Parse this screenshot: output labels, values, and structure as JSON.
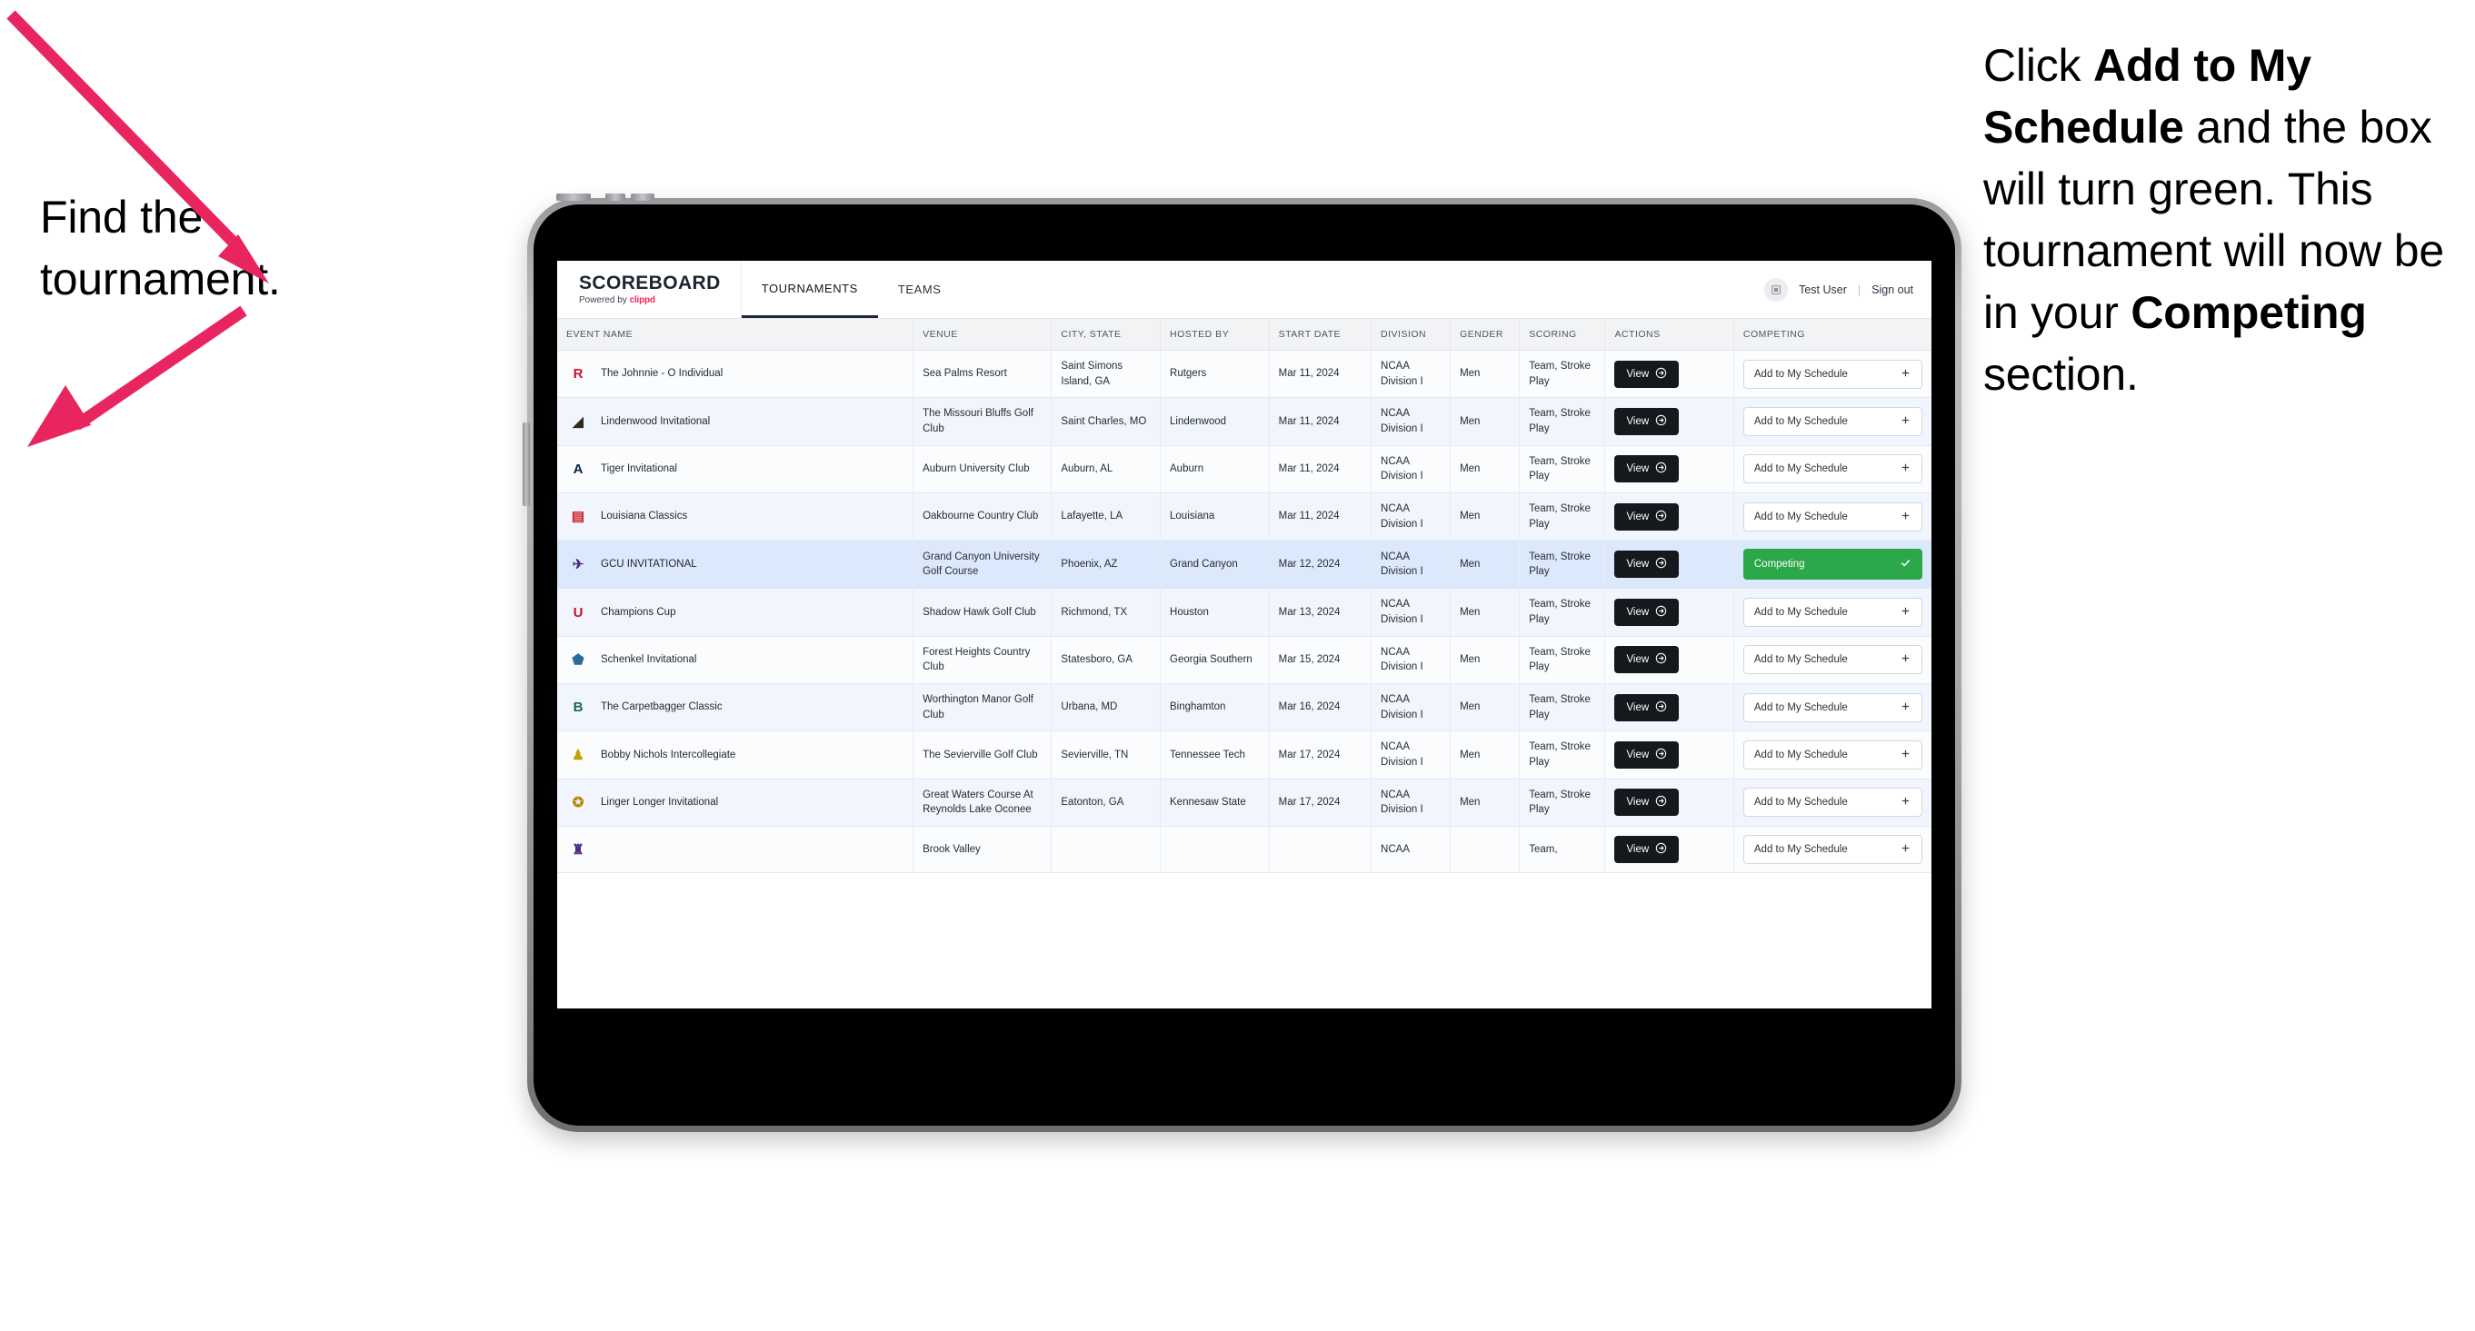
{
  "annotations": {
    "left": {
      "line1": "Find the",
      "line2": "tournament."
    },
    "right": {
      "seg1": "Click ",
      "bold1": "Add to My Schedule",
      "seg2": " and the box will turn green. This tournament will now be in your ",
      "bold2": "Competing",
      "seg3": " section."
    }
  },
  "arrow_color": "#e8255f",
  "colors": {
    "accent_pink": "#f0285c",
    "competing_green": "#2ba84a",
    "view_dark": "#15181d",
    "row_selected": "#dce8fb"
  },
  "app": {
    "brand": {
      "title": "SCOREBOARD",
      "powered_prefix": "Powered by ",
      "powered_name": "clippd"
    },
    "nav": [
      {
        "label": "TOURNAMENTS",
        "active": true
      },
      {
        "label": "TEAMS",
        "active": false
      }
    ],
    "header_right": {
      "avatar_icon": "user-badge-icon",
      "user_name": "Test User",
      "separator": "|",
      "sign_out": "Sign out"
    }
  },
  "table": {
    "columns": [
      "EVENT NAME",
      "VENUE",
      "CITY, STATE",
      "HOSTED BY",
      "START DATE",
      "DIVISION",
      "GENDER",
      "SCORING",
      "ACTIONS",
      "COMPETING"
    ],
    "view_label": "View",
    "add_label": "Add to My Schedule",
    "add_icon": "plus-icon",
    "competing_label": "Competing",
    "competing_icon": "check-icon",
    "view_icon": "arrow-right-circle-icon",
    "rows": [
      {
        "logo": {
          "text": "R",
          "color": "#c8102e",
          "bg": "transparent"
        },
        "event": "The Johnnie - O Individual",
        "venue": "Sea Palms Resort",
        "city": "Saint Simons Island, GA",
        "hosted_by": "Rutgers",
        "start_date": "Mar 11, 2024",
        "division": "NCAA Division I",
        "gender": "Men",
        "scoring": "Team, Stroke Play",
        "competing": false
      },
      {
        "logo": {
          "text": "◢",
          "color": "#2f2a1c",
          "bg": "transparent"
        },
        "event": "Lindenwood Invitational",
        "venue": "The Missouri Bluffs Golf Club",
        "city": "Saint Charles, MO",
        "hosted_by": "Lindenwood",
        "start_date": "Mar 11, 2024",
        "division": "NCAA Division I",
        "gender": "Men",
        "scoring": "Team, Stroke Play",
        "competing": false
      },
      {
        "logo": {
          "text": "A",
          "color": "#03244d",
          "bg": "transparent"
        },
        "event": "Tiger Invitational",
        "venue": "Auburn University Club",
        "city": "Auburn, AL",
        "hosted_by": "Auburn",
        "start_date": "Mar 11, 2024",
        "division": "NCAA Division I",
        "gender": "Men",
        "scoring": "Team, Stroke Play",
        "competing": false
      },
      {
        "logo": {
          "text": "▤",
          "color": "#ce181e",
          "bg": "transparent"
        },
        "event": "Louisiana Classics",
        "venue": "Oakbourne Country Club",
        "city": "Lafayette, LA",
        "hosted_by": "Louisiana",
        "start_date": "Mar 11, 2024",
        "division": "NCAA Division I",
        "gender": "Men",
        "scoring": "Team, Stroke Play",
        "competing": false
      },
      {
        "logo": {
          "text": "✈",
          "color": "#4b2e83",
          "bg": "transparent"
        },
        "event": "GCU INVITATIONAL",
        "venue": "Grand Canyon University Golf Course",
        "city": "Phoenix, AZ",
        "hosted_by": "Grand Canyon",
        "start_date": "Mar 12, 2024",
        "division": "NCAA Division I",
        "gender": "Men",
        "scoring": "Team, Stroke Play",
        "competing": true,
        "selected": true
      },
      {
        "logo": {
          "text": "U",
          "color": "#c8102e",
          "bg": "transparent"
        },
        "event": "Champions Cup",
        "venue": "Shadow Hawk Golf Club",
        "city": "Richmond, TX",
        "hosted_by": "Houston",
        "start_date": "Mar 13, 2024",
        "division": "NCAA Division I",
        "gender": "Men",
        "scoring": "Team, Stroke Play",
        "competing": false
      },
      {
        "logo": {
          "text": "⬟",
          "color": "#2a6b9c",
          "bg": "transparent"
        },
        "event": "Schenkel Invitational",
        "venue": "Forest Heights Country Club",
        "city": "Statesboro, GA",
        "hosted_by": "Georgia Southern",
        "start_date": "Mar 15, 2024",
        "division": "NCAA Division I",
        "gender": "Men",
        "scoring": "Team, Stroke Play",
        "competing": false
      },
      {
        "logo": {
          "text": "B",
          "color": "#1c6b4c",
          "bg": "transparent"
        },
        "event": "The Carpetbagger Classic",
        "venue": "Worthington Manor Golf Club",
        "city": "Urbana, MD",
        "hosted_by": "Binghamton",
        "start_date": "Mar 16, 2024",
        "division": "NCAA Division I",
        "gender": "Men",
        "scoring": "Team, Stroke Play",
        "competing": false
      },
      {
        "logo": {
          "text": "♟",
          "color": "#c2a100",
          "bg": "transparent"
        },
        "event": "Bobby Nichols Intercollegiate",
        "venue": "The Sevierville Golf Club",
        "city": "Sevierville, TN",
        "hosted_by": "Tennessee Tech",
        "start_date": "Mar 17, 2024",
        "division": "NCAA Division I",
        "gender": "Men",
        "scoring": "Team, Stroke Play",
        "competing": false
      },
      {
        "logo": {
          "text": "✪",
          "color": "#b8860b",
          "bg": "transparent"
        },
        "event": "Linger Longer Invitational",
        "venue": "Great Waters Course At Reynolds Lake Oconee",
        "city": "Eatonton, GA",
        "hosted_by": "Kennesaw State",
        "start_date": "Mar 17, 2024",
        "division": "NCAA Division I",
        "gender": "Men",
        "scoring": "Team, Stroke Play",
        "competing": false
      },
      {
        "logo": {
          "text": "♜",
          "color": "#4b2e83",
          "bg": "transparent"
        },
        "event": "",
        "venue": "Brook Valley",
        "city": "",
        "hosted_by": "",
        "start_date": "",
        "division": "NCAA",
        "gender": "",
        "scoring": "Team,",
        "competing": false,
        "partial": true
      }
    ]
  }
}
